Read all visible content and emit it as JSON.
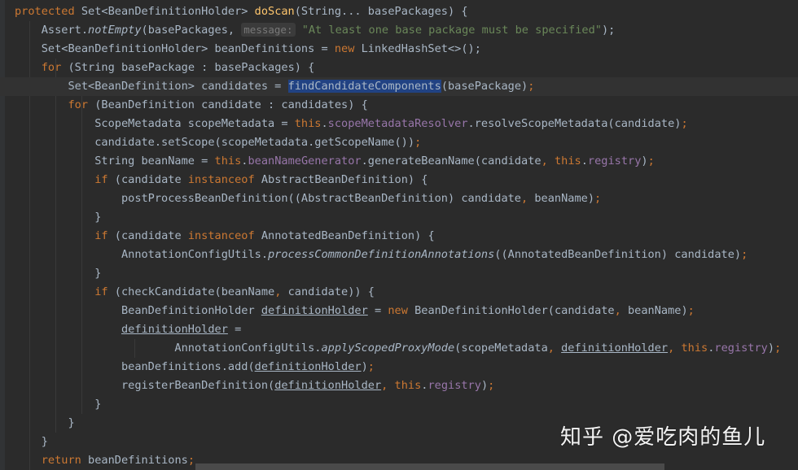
{
  "lines": [
    {
      "current": false,
      "tokens": [
        {
          "t": "protected ",
          "k": "kw"
        },
        {
          "t": "Set<BeanDefinitionHolder> "
        },
        {
          "t": "doScan",
          "k": "fn"
        },
        {
          "t": "(String... basePackages) {"
        }
      ]
    },
    {
      "current": false,
      "tokens": [
        {
          "t": "    Assert."
        },
        {
          "t": "notEmpty",
          "k": "ital"
        },
        {
          "t": "(basePackages, "
        },
        {
          "t": "message:",
          "k": "hint"
        },
        {
          "t": " "
        },
        {
          "t": "\"At least one base package must be specified\"",
          "k": "str"
        },
        {
          "t": ");"
        }
      ]
    },
    {
      "current": false,
      "tokens": [
        {
          "t": "    Set<BeanDefinitionHolder> beanDefinitions = "
        },
        {
          "t": "new ",
          "k": "kw"
        },
        {
          "t": "LinkedHashSet<>();"
        }
      ]
    },
    {
      "current": false,
      "tokens": [
        {
          "t": "    "
        },
        {
          "t": "for ",
          "k": "kw"
        },
        {
          "t": "(String basePackage : basePackages) {"
        }
      ]
    },
    {
      "current": true,
      "tokens": [
        {
          "t": "        Set<BeanDefinition> candidates = "
        },
        {
          "t": "findCandidateComponents",
          "k": "sel"
        },
        {
          "t": "(basePackage)"
        },
        {
          "t": ";",
          "k": "kw"
        }
      ]
    },
    {
      "current": false,
      "tokens": [
        {
          "t": "        "
        },
        {
          "t": "for ",
          "k": "kw"
        },
        {
          "t": "(BeanDefinition candidate : candidates) {"
        }
      ]
    },
    {
      "current": false,
      "tokens": [
        {
          "t": "            ScopeMetadata scopeMetadata = "
        },
        {
          "t": "this",
          "k": "kw"
        },
        {
          "t": "."
        },
        {
          "t": "scopeMetadataResolver",
          "k": "field"
        },
        {
          "t": ".resolveScopeMetadata(candidate)"
        },
        {
          "t": ";",
          "k": "kw"
        }
      ]
    },
    {
      "current": false,
      "tokens": [
        {
          "t": "            candidate.setScope(scopeMetadata.getScopeName())"
        },
        {
          "t": ";",
          "k": "kw"
        }
      ]
    },
    {
      "current": false,
      "tokens": [
        {
          "t": "            String beanName = "
        },
        {
          "t": "this",
          "k": "kw"
        },
        {
          "t": "."
        },
        {
          "t": "beanNameGenerator",
          "k": "field"
        },
        {
          "t": ".generateBeanName(candidate"
        },
        {
          "t": ", ",
          "k": "kw"
        },
        {
          "t": "this",
          "k": "kw"
        },
        {
          "t": "."
        },
        {
          "t": "registry",
          "k": "field"
        },
        {
          "t": ")"
        },
        {
          "t": ";",
          "k": "kw"
        }
      ]
    },
    {
      "current": false,
      "tokens": [
        {
          "t": "            "
        },
        {
          "t": "if ",
          "k": "kw"
        },
        {
          "t": "(candidate "
        },
        {
          "t": "instanceof ",
          "k": "kw"
        },
        {
          "t": "AbstractBeanDefinition) {"
        }
      ]
    },
    {
      "current": false,
      "tokens": [
        {
          "t": "                postProcessBeanDefinition((AbstractBeanDefinition) candidate"
        },
        {
          "t": ", ",
          "k": "kw"
        },
        {
          "t": "beanName)"
        },
        {
          "t": ";",
          "k": "kw"
        }
      ]
    },
    {
      "current": false,
      "tokens": [
        {
          "t": "            }"
        }
      ]
    },
    {
      "current": false,
      "tokens": [
        {
          "t": "            "
        },
        {
          "t": "if ",
          "k": "kw"
        },
        {
          "t": "(candidate "
        },
        {
          "t": "instanceof ",
          "k": "kw"
        },
        {
          "t": "AnnotatedBeanDefinition) {"
        }
      ]
    },
    {
      "current": false,
      "tokens": [
        {
          "t": "                AnnotationConfigUtils."
        },
        {
          "t": "processCommonDefinitionAnnotations",
          "k": "ital"
        },
        {
          "t": "((AnnotatedBeanDefinition) candidate)"
        },
        {
          "t": ";",
          "k": "kw"
        }
      ]
    },
    {
      "current": false,
      "tokens": [
        {
          "t": "            }"
        }
      ]
    },
    {
      "current": false,
      "tokens": [
        {
          "t": "            "
        },
        {
          "t": "if ",
          "k": "kw"
        },
        {
          "t": "(checkCandidate(beanName"
        },
        {
          "t": ", ",
          "k": "kw"
        },
        {
          "t": "candidate)) {"
        }
      ]
    },
    {
      "current": false,
      "tokens": [
        {
          "t": "                BeanDefinitionHolder "
        },
        {
          "t": "definitionHolder",
          "k": "u"
        },
        {
          "t": " = "
        },
        {
          "t": "new ",
          "k": "kw"
        },
        {
          "t": "BeanDefinitionHolder(candidate"
        },
        {
          "t": ", ",
          "k": "kw"
        },
        {
          "t": "beanName)"
        },
        {
          "t": ";",
          "k": "kw"
        }
      ]
    },
    {
      "current": false,
      "tokens": [
        {
          "t": "                "
        },
        {
          "t": "definitionHolder",
          "k": "u"
        },
        {
          "t": " ="
        }
      ]
    },
    {
      "current": false,
      "tokens": [
        {
          "t": "                        AnnotationConfigUtils."
        },
        {
          "t": "applyScopedProxyMode",
          "k": "ital"
        },
        {
          "t": "(scopeMetadata"
        },
        {
          "t": ", ",
          "k": "kw"
        },
        {
          "t": "definitionHolder",
          "k": "u"
        },
        {
          "t": ", ",
          "k": "kw"
        },
        {
          "t": "this",
          "k": "kw"
        },
        {
          "t": "."
        },
        {
          "t": "registry",
          "k": "field"
        },
        {
          "t": ")"
        },
        {
          "t": ";",
          "k": "kw"
        }
      ]
    },
    {
      "current": false,
      "tokens": [
        {
          "t": "                beanDefinitions.add("
        },
        {
          "t": "definitionHolder",
          "k": "u"
        },
        {
          "t": ")"
        },
        {
          "t": ";",
          "k": "kw"
        }
      ]
    },
    {
      "current": false,
      "tokens": [
        {
          "t": "                registerBeanDefinition("
        },
        {
          "t": "definitionHolder",
          "k": "u"
        },
        {
          "t": ", ",
          "k": "kw"
        },
        {
          "t": "this",
          "k": "kw"
        },
        {
          "t": "."
        },
        {
          "t": "registry",
          "k": "field"
        },
        {
          "t": ")"
        },
        {
          "t": ";",
          "k": "kw"
        }
      ]
    },
    {
      "current": false,
      "tokens": [
        {
          "t": "            }"
        }
      ]
    },
    {
      "current": false,
      "tokens": [
        {
          "t": "        }"
        }
      ]
    },
    {
      "current": false,
      "tokens": [
        {
          "t": "    }"
        }
      ]
    },
    {
      "current": false,
      "tokens": [
        {
          "t": "    "
        },
        {
          "t": "return ",
          "k": "kw"
        },
        {
          "t": "beanDefinitions"
        },
        {
          "t": ";",
          "k": "kw"
        }
      ]
    }
  ],
  "watermark": "知乎 @爱吃肉的鱼儿",
  "colors": {
    "background": "#2b2b2b",
    "current_line": "#323232",
    "text": "#a9b7c6",
    "keyword": "#cc7832",
    "field": "#9876aa",
    "string": "#6a8759",
    "method_declaration": "#ffc66d",
    "selection": "#214283"
  }
}
